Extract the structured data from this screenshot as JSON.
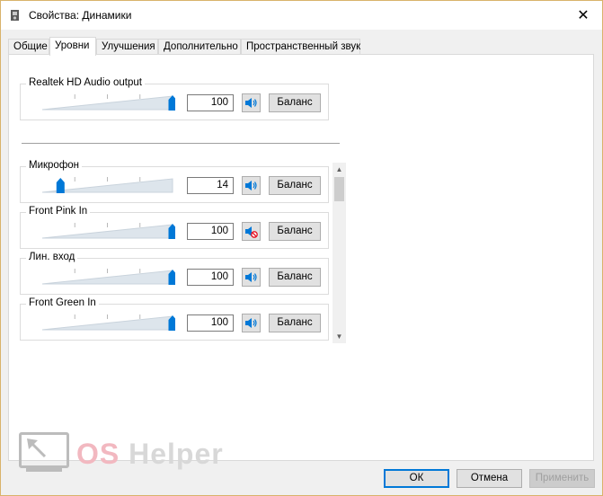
{
  "window": {
    "title": "Свойства: Динамики"
  },
  "tabs": [
    {
      "label": "Общие",
      "active": false
    },
    {
      "label": "Уровни",
      "active": true
    },
    {
      "label": "Улучшения",
      "active": false
    },
    {
      "label": "Дополнительно",
      "active": false
    },
    {
      "label": "Пространственный звук",
      "active": false
    }
  ],
  "output": {
    "label": "Realtek HD Audio output",
    "value": "100",
    "level": 100,
    "balance_label": "Баланс",
    "muted": false
  },
  "inputs": [
    {
      "label": "Микрофон",
      "value": "14",
      "level": 14,
      "balance_label": "Баланс",
      "muted": false
    },
    {
      "label": "Front Pink In",
      "value": "100",
      "level": 100,
      "balance_label": "Баланс",
      "muted": true
    },
    {
      "label": "Лин. вход",
      "value": "100",
      "level": 100,
      "balance_label": "Баланс",
      "muted": false
    },
    {
      "label": "Front Green In",
      "value": "100",
      "level": 100,
      "balance_label": "Баланс",
      "muted": false
    }
  ],
  "watermark": {
    "os": "OS",
    "helper": "Helper"
  },
  "footer": {
    "ok": "ОК",
    "cancel": "Отмена",
    "apply": "Применить"
  },
  "colors": {
    "accent": "#0078d7",
    "mute_red": "#e81123"
  }
}
